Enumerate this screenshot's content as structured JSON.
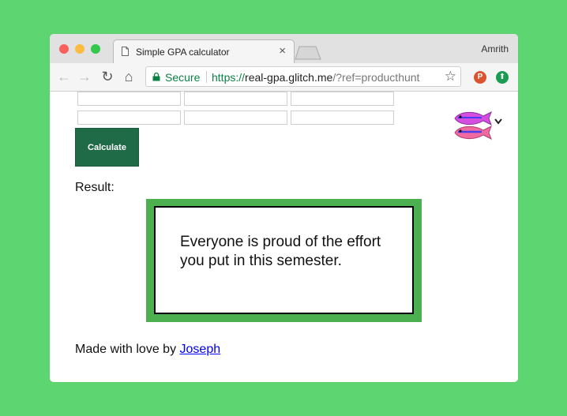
{
  "browser": {
    "tab_title": "Simple GPA calculator",
    "tab_close": "×",
    "user_name": "Amrith",
    "secure_label": "Secure",
    "url_scheme": "https://",
    "url_host": "real-gpa.glitch.me",
    "url_rest": "/?ref=producthunt",
    "ext_product_hunt": "P",
    "ext_upload": "⬆",
    "star": "☆",
    "nav_back": "←",
    "nav_forward": "→",
    "nav_reload": "↻",
    "nav_home": "⌂"
  },
  "form": {
    "inputs_row1": [
      "",
      "",
      ""
    ],
    "inputs_row2": [
      "",
      "",
      ""
    ],
    "calculate_label": "Calculate"
  },
  "result": {
    "label": "Result:",
    "message": "Everyone is proud of the effort you put in this semester."
  },
  "footer": {
    "text": "Made with love by ",
    "author_link": "Joseph"
  },
  "colors": {
    "page_background": "#5dd672",
    "button": "#206b47",
    "result_frame": "#4caf50",
    "link": "#0000ee"
  },
  "icons": [
    "document-icon",
    "lock-icon",
    "star-icon",
    "glitch-fish-icon",
    "chevron-down-icon"
  ]
}
